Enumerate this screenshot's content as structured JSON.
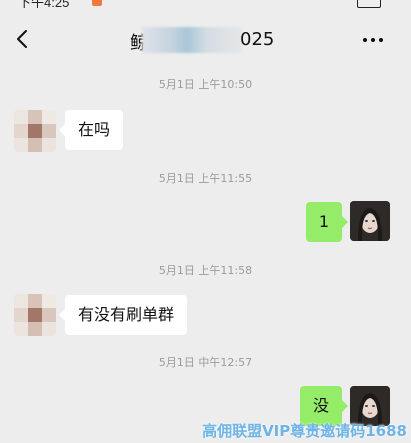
{
  "status_bar": {
    "time": "下午4:25"
  },
  "nav": {
    "title_prefix": "鲸",
    "title_suffix": "025",
    "back_icon": "chevron-left-icon",
    "more_icon": "more-dots-icon"
  },
  "messages": [
    {
      "type": "timestamp",
      "text": "5月1日 上午10:50"
    },
    {
      "type": "incoming",
      "text": "在吗"
    },
    {
      "type": "timestamp",
      "text": "5月1日 上午11:55"
    },
    {
      "type": "outgoing",
      "text": "1"
    },
    {
      "type": "timestamp",
      "text": "5月1日 上午11:58"
    },
    {
      "type": "incoming",
      "text": "有没有刷单群"
    },
    {
      "type": "timestamp",
      "text": "5月1日 中午12:57"
    },
    {
      "type": "outgoing",
      "text": "没"
    }
  ],
  "watermark": "高佣联盟VIP尊贵邀请码1688",
  "colors": {
    "background": "#ededed",
    "bubble_incoming": "#ffffff",
    "bubble_outgoing": "#95ec69",
    "timestamp": "#9b9b9b"
  }
}
